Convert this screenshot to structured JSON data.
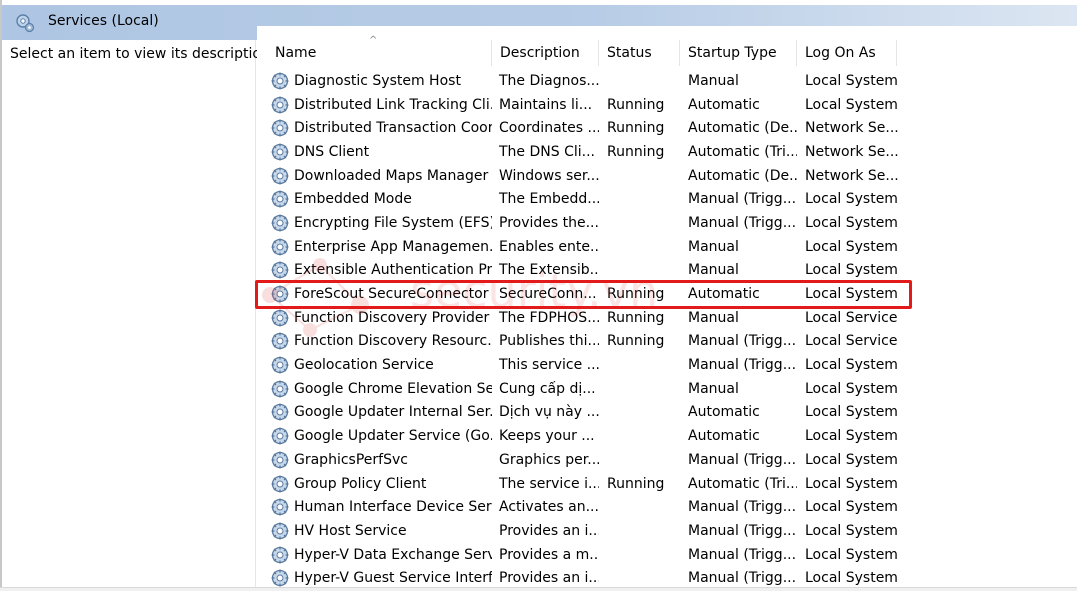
{
  "window": {
    "title": "Services (Local)"
  },
  "left_pane": {
    "description": "Select an item to view its description."
  },
  "columns": [
    "Name",
    "Description",
    "Status",
    "Startup Type",
    "Log On As"
  ],
  "sort_indicator": "^",
  "rows": [
    {
      "name": "Diagnostic System Host",
      "desc": "The Diagnos...",
      "status": "",
      "startup": "Manual",
      "logon": "Local System"
    },
    {
      "name": "Distributed Link Tracking Cli...",
      "desc": "Maintains li...",
      "status": "Running",
      "startup": "Automatic",
      "logon": "Local System"
    },
    {
      "name": "Distributed Transaction Coor...",
      "desc": "Coordinates ...",
      "status": "Running",
      "startup": "Automatic (De...",
      "logon": "Network Se..."
    },
    {
      "name": "DNS Client",
      "desc": "The DNS Cli...",
      "status": "Running",
      "startup": "Automatic (Tri...",
      "logon": "Network Se..."
    },
    {
      "name": "Downloaded Maps Manager",
      "desc": "Windows ser...",
      "status": "",
      "startup": "Automatic (De...",
      "logon": "Network Se..."
    },
    {
      "name": "Embedded Mode",
      "desc": "The Embedd...",
      "status": "",
      "startup": "Manual (Trigg...",
      "logon": "Local System"
    },
    {
      "name": "Encrypting File System (EFS)",
      "desc": "Provides the...",
      "status": "",
      "startup": "Manual (Trigg...",
      "logon": "Local System"
    },
    {
      "name": "Enterprise App Managemen...",
      "desc": "Enables ente...",
      "status": "",
      "startup": "Manual",
      "logon": "Local System"
    },
    {
      "name": "Extensible Authentication Pr...",
      "desc": "The Extensib...",
      "status": "",
      "startup": "Manual",
      "logon": "Local System"
    },
    {
      "name": "ForeScout SecureConnector ...",
      "desc": "SecureConn...",
      "status": "Running",
      "startup": "Automatic",
      "logon": "Local System"
    },
    {
      "name": "Function Discovery Provider ...",
      "desc": "The FDPHOS...",
      "status": "Running",
      "startup": "Manual",
      "logon": "Local Service"
    },
    {
      "name": "Function Discovery Resourc...",
      "desc": "Publishes thi...",
      "status": "Running",
      "startup": "Manual (Trigg...",
      "logon": "Local Service"
    },
    {
      "name": "Geolocation Service",
      "desc": "This service ...",
      "status": "",
      "startup": "Manual (Trigg...",
      "logon": "Local System"
    },
    {
      "name": "Google Chrome Elevation Se...",
      "desc": "Cung cấp dị...",
      "status": "",
      "startup": "Manual",
      "logon": "Local System"
    },
    {
      "name": "Google Updater Internal Ser...",
      "desc": "Dịch vụ này ...",
      "status": "",
      "startup": "Automatic",
      "logon": "Local System"
    },
    {
      "name": "Google Updater Service (Go...",
      "desc": "Keeps your ...",
      "status": "",
      "startup": "Automatic",
      "logon": "Local System"
    },
    {
      "name": "GraphicsPerfSvc",
      "desc": "Graphics per...",
      "status": "",
      "startup": "Manual (Trigg...",
      "logon": "Local System"
    },
    {
      "name": "Group Policy Client",
      "desc": "The service i...",
      "status": "Running",
      "startup": "Automatic (Tri...",
      "logon": "Local System"
    },
    {
      "name": "Human Interface Device Serv...",
      "desc": "Activates an...",
      "status": "",
      "startup": "Manual (Trigg...",
      "logon": "Local System"
    },
    {
      "name": "HV Host Service",
      "desc": "Provides an i...",
      "status": "",
      "startup": "Manual (Trigg...",
      "logon": "Local System"
    },
    {
      "name": "Hyper-V Data Exchange Serv...",
      "desc": "Provides a m...",
      "status": "",
      "startup": "Manual (Trigg...",
      "logon": "Local System"
    },
    {
      "name": "Hyper-V Guest Service Interf...",
      "desc": "Provides an i...",
      "status": "",
      "startup": "Manual (Trigg...",
      "logon": "Local System"
    }
  ],
  "highlighted_row": "ForeScout SecureConnector ...",
  "colors": {
    "highlight": "#e21a1a",
    "header_band": "#b7cce6"
  },
  "icons": {
    "title": "services-gear-icon",
    "row": "service-gear-icon"
  },
  "watermark": {
    "text": "security.vn"
  }
}
